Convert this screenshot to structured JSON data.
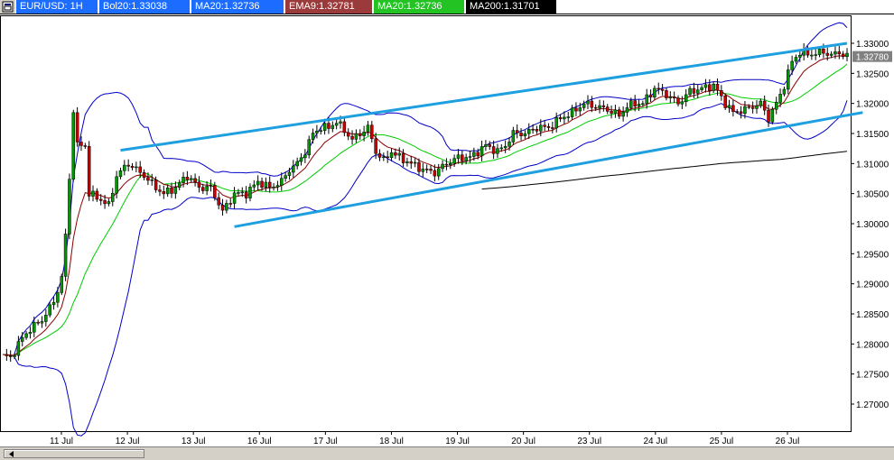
{
  "header": {
    "window_icon": "window-menu-icon",
    "symbol": "EUR/USD: 1H",
    "bol20": "Bol20:1.33038",
    "ma20_a": "MA20:1.32736",
    "ema9": "EMA9:1.32781",
    "ma20_b": "MA20:1.32736",
    "ma200": "MA200:1.31701"
  },
  "colors": {
    "bull": "#009900",
    "bear": "#cc0000",
    "bollinger": "#0000c8",
    "ema9": "#8b0000",
    "ma20": "#00cc00",
    "ma200": "#000000",
    "channel": "#1ea0e0",
    "last_price_bg": "#808080"
  },
  "scrollbar": {
    "icon": "scroll-left-icon"
  },
  "chart_data": {
    "type": "candlestick",
    "x_labels": [
      "11 Jul",
      "12 Jul",
      "13 Jul",
      "16 Jul",
      "17 Jul",
      "18 Jul",
      "19 Jul",
      "20 Jul",
      "23 Jul",
      "24 Jul",
      "25 Jul",
      "26 Jul"
    ],
    "y_ticks": [
      "1.33000",
      "1.32500",
      "1.32000",
      "1.31500",
      "1.31000",
      "1.30500",
      "1.30000",
      "1.29500",
      "1.29000",
      "1.28500",
      "1.28000",
      "1.27500",
      "1.27000"
    ],
    "ylim": [
      1.2655,
      1.3345
    ],
    "last_price": "1.32780",
    "series_names": [
      "Bol20",
      "EMA9",
      "MA20",
      "MA200"
    ],
    "anchors": [
      {
        "i": 0,
        "y": 1.278
      },
      {
        "i": 2,
        "y": 1.2777
      },
      {
        "i": 5,
        "y": 1.281
      },
      {
        "i": 7,
        "y": 1.2825
      },
      {
        "i": 10,
        "y": 1.284
      },
      {
        "i": 13,
        "y": 1.287
      },
      {
        "i": 15,
        "y": 1.291
      },
      {
        "i": 16,
        "y": 1.298
      },
      {
        "i": 17,
        "y": 1.3075
      },
      {
        "i": 18,
        "y": 1.319
      },
      {
        "i": 19,
        "y": 1.313
      },
      {
        "i": 21,
        "y": 1.313
      },
      {
        "i": 22,
        "y": 1.305
      },
      {
        "i": 25,
        "y": 1.304
      },
      {
        "i": 27,
        "y": 1.303
      },
      {
        "i": 29,
        "y": 1.308
      },
      {
        "i": 32,
        "y": 1.31
      },
      {
        "i": 36,
        "y": 1.308
      },
      {
        "i": 39,
        "y": 1.306
      },
      {
        "i": 41,
        "y": 1.305
      },
      {
        "i": 44,
        "y": 1.306
      },
      {
        "i": 47,
        "y": 1.308
      },
      {
        "i": 50,
        "y": 1.306
      },
      {
        "i": 53,
        "y": 1.306
      },
      {
        "i": 56,
        "y": 1.302
      },
      {
        "i": 59,
        "y": 1.305
      },
      {
        "i": 62,
        "y": 1.305
      },
      {
        "i": 65,
        "y": 1.307
      },
      {
        "i": 68,
        "y": 1.306
      },
      {
        "i": 71,
        "y": 1.307
      },
      {
        "i": 73,
        "y": 1.309
      },
      {
        "i": 75,
        "y": 1.31
      },
      {
        "i": 77,
        "y": 1.312
      },
      {
        "i": 79,
        "y": 1.315
      },
      {
        "i": 81,
        "y": 1.316
      },
      {
        "i": 83,
        "y": 1.316
      },
      {
        "i": 85,
        "y": 1.317
      },
      {
        "i": 87,
        "y": 1.3155
      },
      {
        "i": 89,
        "y": 1.314
      },
      {
        "i": 91,
        "y": 1.315
      },
      {
        "i": 93,
        "y": 1.316
      },
      {
        "i": 95,
        "y": 1.312
      },
      {
        "i": 97,
        "y": 1.3105
      },
      {
        "i": 99,
        "y": 1.312
      },
      {
        "i": 101,
        "y": 1.311
      },
      {
        "i": 104,
        "y": 1.31
      },
      {
        "i": 107,
        "y": 1.309
      },
      {
        "i": 110,
        "y": 1.3085
      },
      {
        "i": 113,
        "y": 1.31
      },
      {
        "i": 116,
        "y": 1.311
      },
      {
        "i": 119,
        "y": 1.311
      },
      {
        "i": 121,
        "y": 1.312
      },
      {
        "i": 123,
        "y": 1.313
      },
      {
        "i": 126,
        "y": 1.312
      },
      {
        "i": 128,
        "y": 1.313
      },
      {
        "i": 130,
        "y": 1.315
      },
      {
        "i": 133,
        "y": 1.315
      },
      {
        "i": 136,
        "y": 1.316
      },
      {
        "i": 139,
        "y": 1.316
      },
      {
        "i": 142,
        "y": 1.3175
      },
      {
        "i": 145,
        "y": 1.3185
      },
      {
        "i": 148,
        "y": 1.32
      },
      {
        "i": 151,
        "y": 1.3195
      },
      {
        "i": 154,
        "y": 1.319
      },
      {
        "i": 157,
        "y": 1.318
      },
      {
        "i": 159,
        "y": 1.3195
      },
      {
        "i": 161,
        "y": 1.32
      },
      {
        "i": 163,
        "y": 1.32
      },
      {
        "i": 166,
        "y": 1.3225
      },
      {
        "i": 169,
        "y": 1.3215
      },
      {
        "i": 172,
        "y": 1.32
      },
      {
        "i": 175,
        "y": 1.322
      },
      {
        "i": 178,
        "y": 1.3225
      },
      {
        "i": 181,
        "y": 1.323
      },
      {
        "i": 184,
        "y": 1.32
      },
      {
        "i": 186,
        "y": 1.3185
      },
      {
        "i": 189,
        "y": 1.319
      },
      {
        "i": 191,
        "y": 1.3195
      },
      {
        "i": 193,
        "y": 1.32
      },
      {
        "i": 195,
        "y": 1.3175
      },
      {
        "i": 197,
        "y": 1.32
      },
      {
        "i": 199,
        "y": 1.323
      },
      {
        "i": 201,
        "y": 1.327
      },
      {
        "i": 203,
        "y": 1.3285
      },
      {
        "i": 205,
        "y": 1.3282
      },
      {
        "i": 207,
        "y": 1.3283
      },
      {
        "i": 209,
        "y": 1.3286
      },
      {
        "i": 211,
        "y": 1.328
      },
      {
        "i": 213,
        "y": 1.3285
      },
      {
        "i": 215,
        "y": 1.3278
      }
    ],
    "channel": [
      {
        "from": [
          30,
          1.3122
        ],
        "to": [
          215,
          1.33
        ]
      },
      {
        "from": [
          59,
          1.2995
        ],
        "to": [
          219,
          1.3185
        ]
      }
    ]
  }
}
